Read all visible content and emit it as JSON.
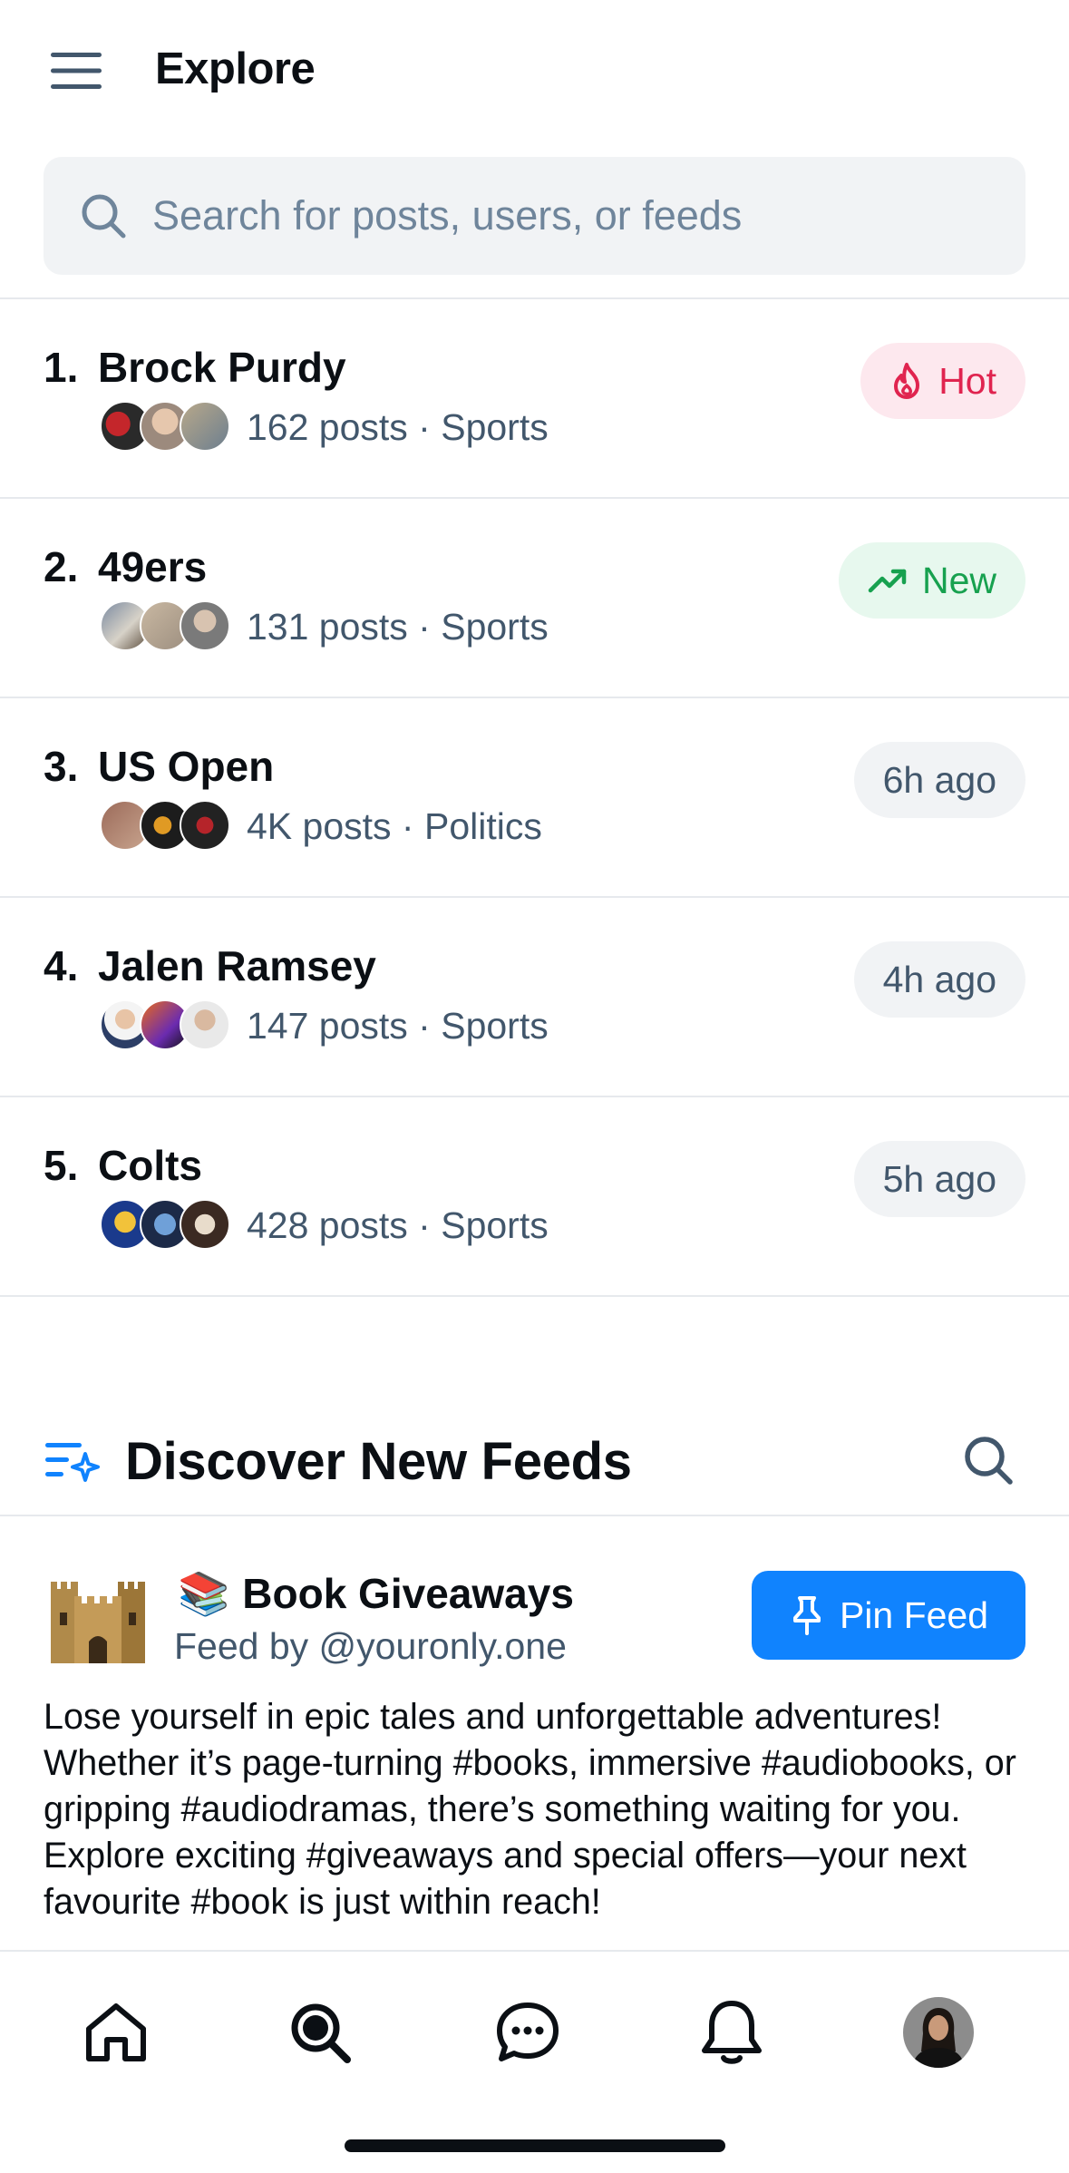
{
  "header": {
    "title": "Explore",
    "menu_icon": "hamburger-icon"
  },
  "search": {
    "placeholder": "Search for posts, users, or feeds",
    "icon": "search-icon"
  },
  "trending": [
    {
      "rank": "1.",
      "name": "Brock Purdy",
      "meta": "162 posts · Sports",
      "badge": "Hot",
      "badge_icon": "flame-icon",
      "badge_style": "hot"
    },
    {
      "rank": "2.",
      "name": "49ers",
      "meta": "131 posts · Sports",
      "badge": "New",
      "badge_icon": "trending-up-icon",
      "badge_style": "new"
    },
    {
      "rank": "3.",
      "name": "US Open",
      "meta": "4K posts · Politics",
      "badge": "6h ago",
      "badge_style": "time"
    },
    {
      "rank": "4.",
      "name": "Jalen Ramsey",
      "meta": "147 posts · Sports",
      "badge": "4h ago",
      "badge_style": "time"
    },
    {
      "rank": "5.",
      "name": "Colts",
      "meta": "428 posts · Sports",
      "badge": "5h ago",
      "badge_style": "time"
    }
  ],
  "discover": {
    "title": "Discover New Feeds",
    "icon": "sparkle-list-icon",
    "search_icon": "search-icon"
  },
  "feed": {
    "emoji": "📚",
    "name": "Book Giveaways",
    "by": "Feed by @youronly.one",
    "pin_label": "Pin Feed",
    "pin_icon": "pin-icon",
    "description": "Lose yourself in epic tales and unforgettable adventures! Whether it’s page-turning #books, immersive #audiobooks, or gripping #audiodramas, there’s something waiting for you. Explore exciting #giveaways and special offers—your next favourite #book is just within reach!"
  },
  "tabbar": {
    "tabs": [
      "home-icon",
      "search-icon",
      "chat-icon",
      "bell-icon",
      "profile-avatar"
    ],
    "active": "search-icon"
  },
  "colors": {
    "text": "#0b0f14",
    "muted": "#42576c",
    "placeholder": "#6f859b",
    "accent": "#1083fe",
    "hot_bg": "#fde8ee",
    "hot_fg": "#e0244f",
    "new_bg": "#e7f8ee",
    "new_fg": "#17a14f",
    "time_bg": "#f1f3f5",
    "time_fg": "#42576c",
    "divider": "#e6e9ed"
  }
}
